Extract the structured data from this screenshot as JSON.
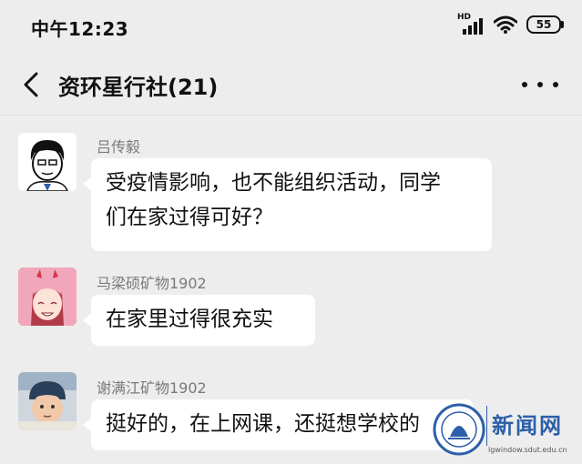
{
  "status_bar": {
    "time": "中午12:23",
    "network": "HD",
    "battery": "55"
  },
  "nav": {
    "title": "资环星行社(21)"
  },
  "messages": [
    {
      "sender": "吕传毅",
      "lines": [
        "受疫情影响，也不能组织活动，同学",
        "们在家过得可好？"
      ]
    },
    {
      "sender": "马梁硕矿物1902",
      "lines": [
        "在家里过得很充实"
      ]
    },
    {
      "sender": "谢满江矿物1902",
      "lines": [
        "挺好的，在上网课，还挺想学校的"
      ]
    }
  ],
  "watermark": {
    "title": "新闻网",
    "url": "lgwindow.sdut.edu.cn"
  },
  "colors": {
    "background": "#ededed",
    "bubble": "#ffffff",
    "watermark_blue": "#2d5fa8"
  }
}
